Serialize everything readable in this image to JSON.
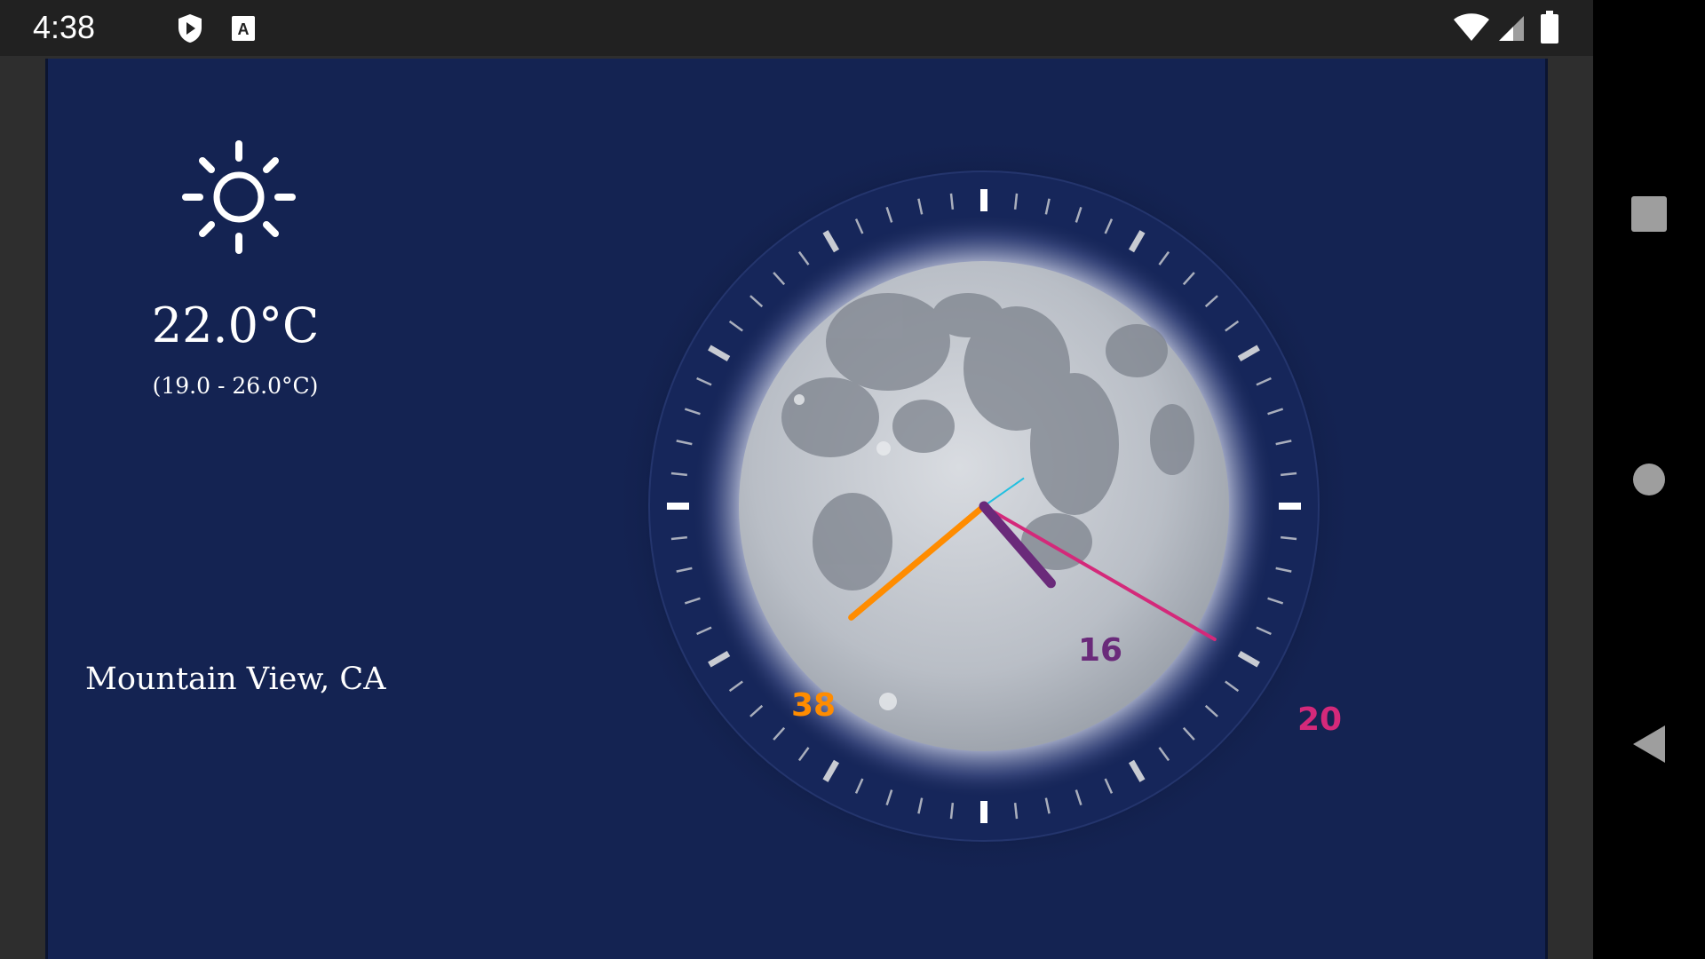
{
  "status_bar": {
    "time": "4:38",
    "icons": [
      "play-protect-icon",
      "text-a-icon"
    ],
    "right_icons": [
      "wifi-icon",
      "signal-icon",
      "battery-icon"
    ]
  },
  "nav_bar": {
    "buttons": [
      "recents-button",
      "home-button",
      "back-button"
    ]
  },
  "weather": {
    "icon": "sun-icon",
    "temperature": "22.0°C",
    "range": "(19.0 - 26.0°C)",
    "location": "Mountain View, CA"
  },
  "clock": {
    "hour_label": "16",
    "minute_label": "38",
    "second_label": "20",
    "hour": 16,
    "minute": 38,
    "second": 20,
    "colors": {
      "hour_hand": "#6a2a7a",
      "minute_hand": "#ff8c00",
      "second_hand": "#d4297a",
      "sweep": "#22c0e0",
      "background": "#142352"
    }
  }
}
